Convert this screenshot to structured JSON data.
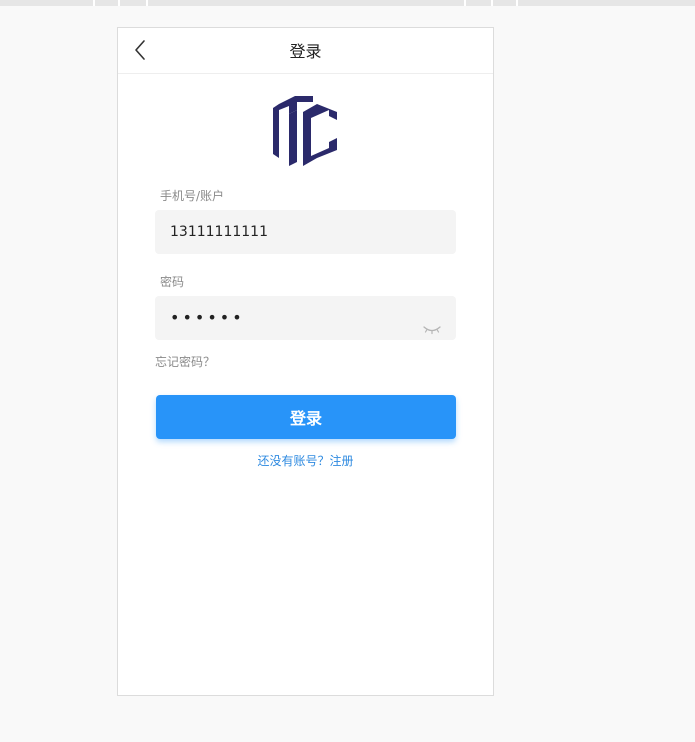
{
  "nav": {
    "title": "登录",
    "back_icon": "chevron-left-icon"
  },
  "logo": {
    "icon": "mc-logo-icon",
    "color": "#2b2a6b"
  },
  "form": {
    "account_label": "手机号/账户",
    "account_value": "13111111111",
    "password_label": "密码",
    "password_value": "••••••",
    "eye_icon": "eye-closed-icon",
    "forgot_label": "忘记密码？"
  },
  "actions": {
    "login_label": "登录",
    "register_label": "还没有账号？注册",
    "accent_color": "#2894f9"
  }
}
